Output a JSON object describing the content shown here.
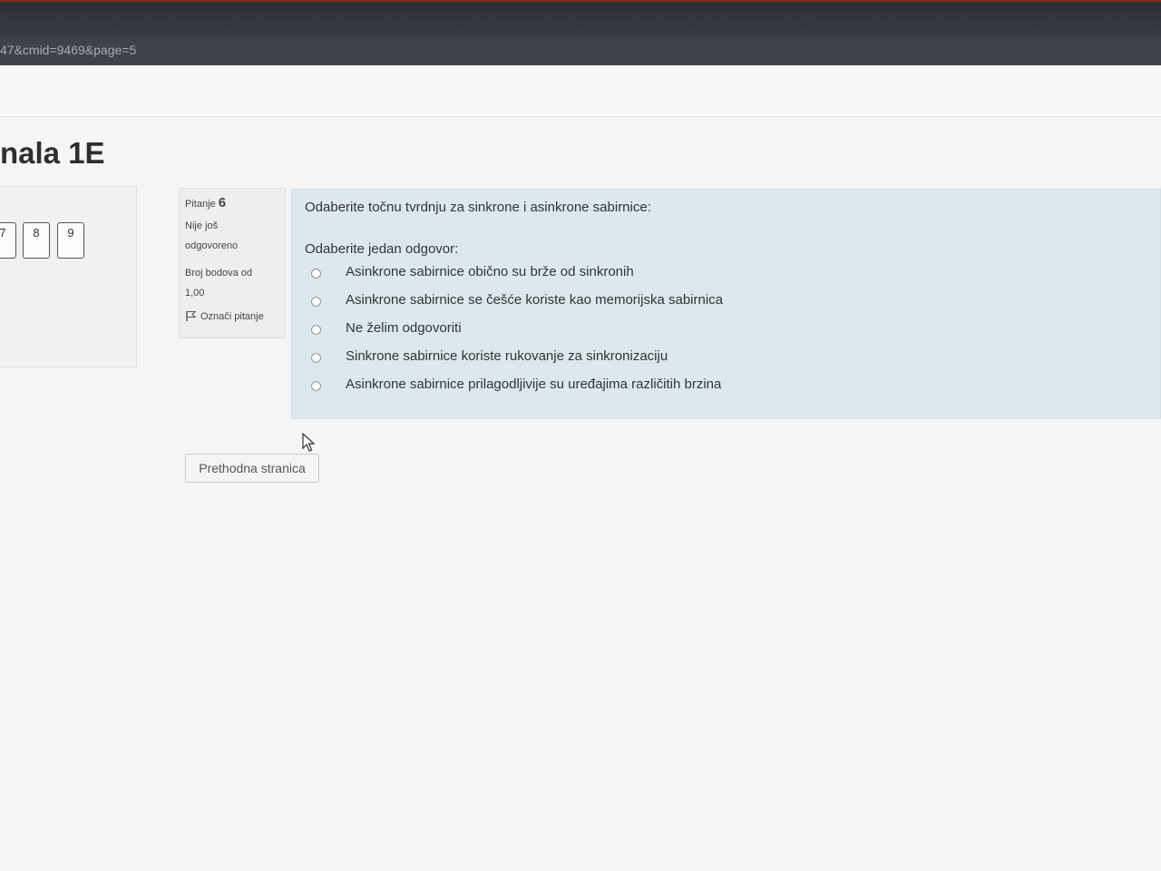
{
  "browser": {
    "url_fragment": "47&cmid=9469&page=5"
  },
  "course": {
    "title": "nala 1E"
  },
  "quiz_nav": {
    "buttons": [
      "7",
      "8",
      "9"
    ]
  },
  "question_info": {
    "label": "Pitanje",
    "number": "6",
    "status_line1": "Nije još",
    "status_line2": "odgovoreno",
    "marks_line1": "Broj bodova od",
    "marks_line2": "1,00",
    "flag_label": "Označi pitanje"
  },
  "question": {
    "text": "Odaberite točnu tvrdnju za sinkrone i asinkrone sabirnice:",
    "prompt": "Odaberite jedan odgovor:",
    "answers": [
      "Asinkrone sabirnice obično su brže od sinkronih",
      "Asinkrone sabirnice se češće koriste kao memorijska sabirnica",
      "Ne želim odgovoriti",
      "Sinkrone sabirnice koriste rukovanje za sinkronizaciju",
      "Asinkrone sabirnice prilagodljivije su uređajima različitih brzina"
    ]
  },
  "navigation": {
    "prev_label": "Prethodna stranica"
  },
  "colors": {
    "content_bg": "#dbe9ee",
    "info_bg": "#eeeeee",
    "browser_chrome": "#3e4248"
  },
  "icons": [
    "flag-icon",
    "mouse-cursor-icon",
    "radio-icon"
  ]
}
